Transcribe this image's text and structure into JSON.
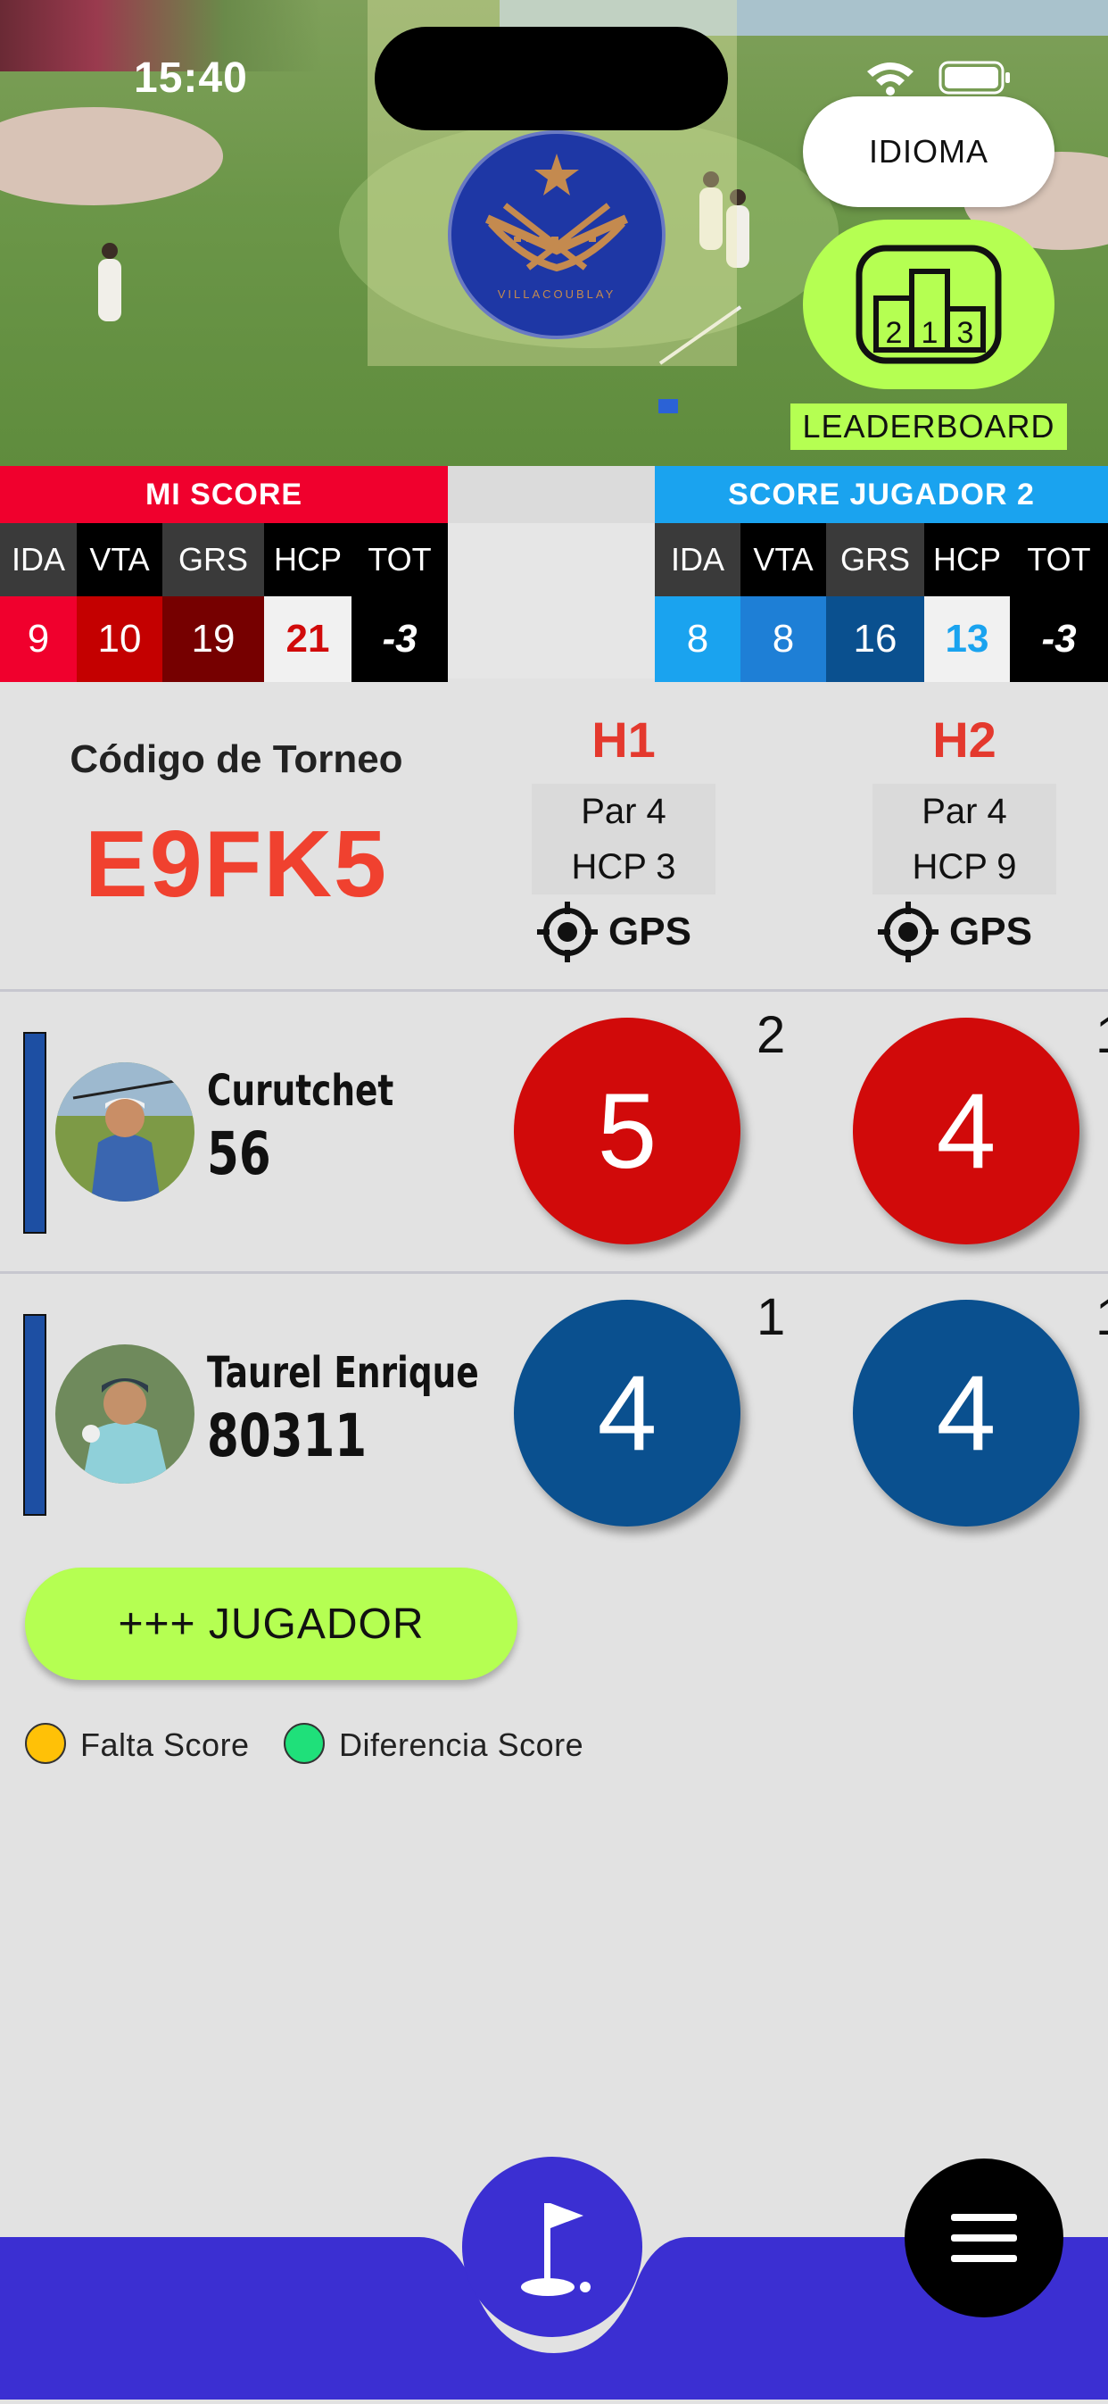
{
  "status_bar": {
    "time": "15:40"
  },
  "header": {
    "idioma_label": "IDIOMA",
    "leaderboard_label": "LEADERBOARD",
    "logo_text": "VILLACOUBLAY"
  },
  "mi_score": {
    "title": "MI SCORE",
    "labels": [
      "IDA",
      "VTA",
      "GRS",
      "HCP",
      "TOT"
    ],
    "values": [
      "9",
      "10",
      "19",
      "21",
      "-3"
    ]
  },
  "score_jugador2": {
    "title": "SCORE JUGADOR 2",
    "labels": [
      "IDA",
      "VTA",
      "GRS",
      "HCP",
      "TOT"
    ],
    "values": [
      "8",
      "8",
      "16",
      "13",
      "-3"
    ]
  },
  "tournament": {
    "code_label": "Código de Torneo",
    "code": "E9FK5"
  },
  "holes": [
    {
      "title": "H1",
      "par": "Par 4",
      "hcp": "HCP 3",
      "gps": "GPS"
    },
    {
      "title": "H2",
      "par": "Par 4",
      "hcp": "HCP 9",
      "gps": "GPS"
    }
  ],
  "players": [
    {
      "name": "Curutchet",
      "sub": "56",
      "scores": [
        "5",
        "4"
      ],
      "strokes": [
        "2",
        "1"
      ]
    },
    {
      "name": "Taurel Enrique",
      "sub": "80311",
      "scores": [
        "4",
        "4"
      ],
      "strokes": [
        "1",
        "1"
      ]
    }
  ],
  "add_player_label": "+++ JUGADOR",
  "legend": [
    {
      "label": "Falta Score",
      "color": "#ffc107"
    },
    {
      "label": "Diferencia Score",
      "color": "#1fe07a"
    }
  ],
  "colors": {
    "accent_green": "#b5ff52",
    "mi_score_red": "#f0002d",
    "jugador2_blue": "#1aa3ef",
    "score_red": "#d10a0a",
    "score_blue": "#0a508f",
    "nav_purple": "#3b2fd2"
  }
}
